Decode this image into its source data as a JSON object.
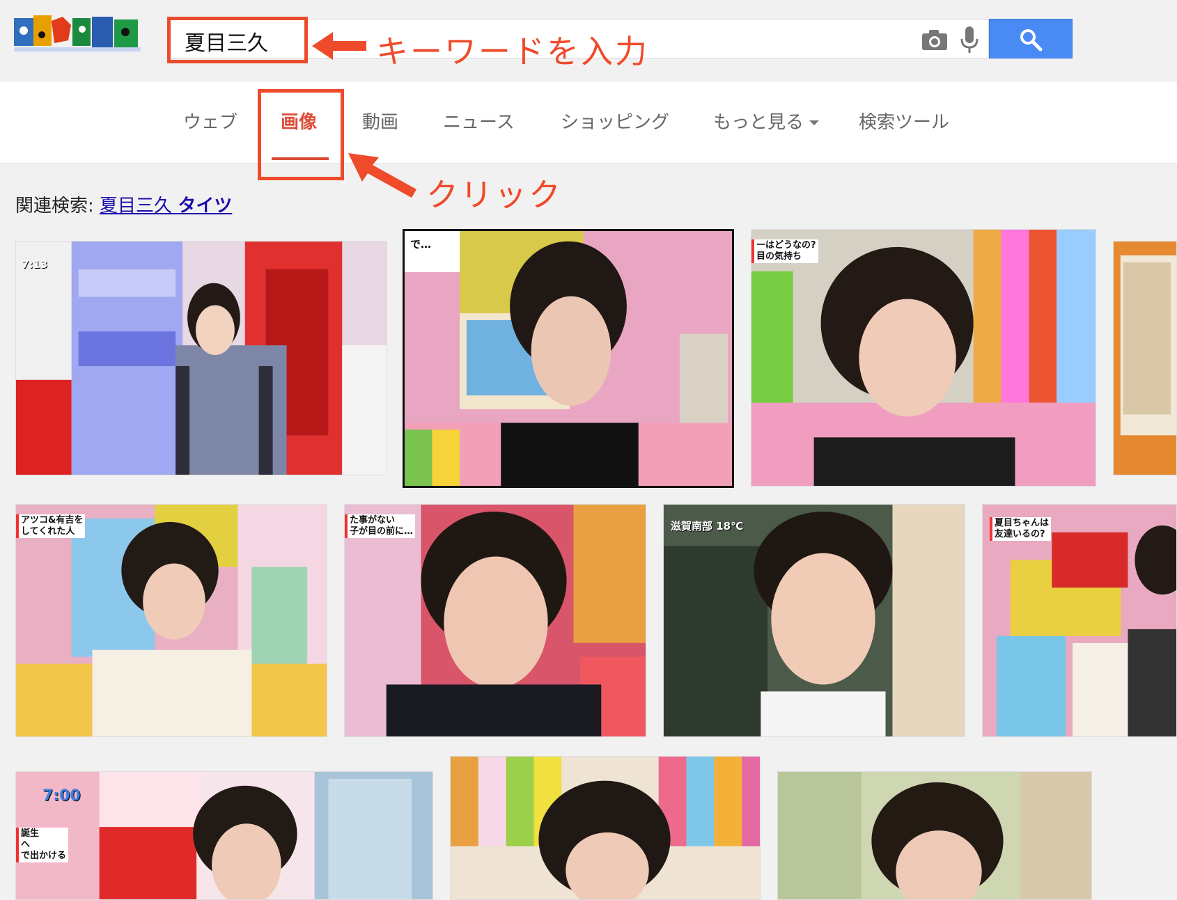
{
  "search": {
    "query": "夏目三久"
  },
  "callouts": {
    "keyword": "キーワードを入力",
    "click": "クリック"
  },
  "nav": {
    "tabs": [
      "ウェブ",
      "画像",
      "動画",
      "ニュース",
      "ショッピング",
      "もっと見る",
      "検索ツール"
    ],
    "active": "画像"
  },
  "related": {
    "label": "関連検索:",
    "link_plain": "夏目三久",
    "link_bold": "タイツ"
  },
  "thumbnails": {
    "t1_time": "7:13",
    "t3_caption": "ーはどうなの?\n目の気持ち",
    "t4_caption": "アツコ&有吉を\nしてくれた人",
    "t5_caption": "た事がない\n子が目の前に…",
    "t6_weather": "滋賀南部 18℃",
    "t7_caption": "夏目ちゃんは\n友達いるの?",
    "t8_time": "7:00",
    "t8_side": "誕生\nへ\nで出かける"
  },
  "colors": {
    "accent_red": "#dd4b39",
    "callout_orange": "#ef4a2a",
    "search_blue": "#4a8af4",
    "link_blue": "#1a0dab"
  }
}
